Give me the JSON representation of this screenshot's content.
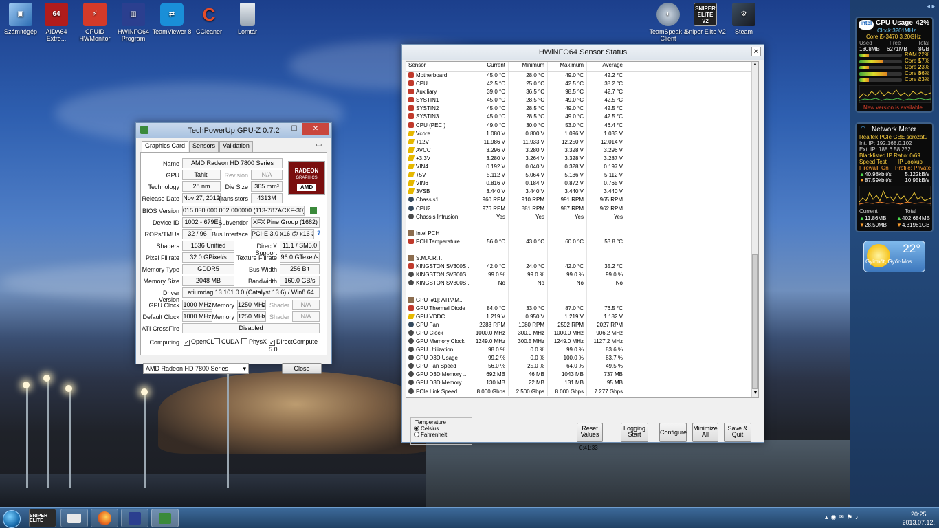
{
  "desktop_icons_left": [
    {
      "label": "Számítógép",
      "icon": "computer-icon"
    },
    {
      "label": "AIDA64 Extre...",
      "icon": "aida64-icon"
    },
    {
      "label": "CPUID HWMonitor",
      "icon": "hwmonitor-icon"
    },
    {
      "label": "HWiNFO64 Program",
      "icon": "hwinfo-icon"
    },
    {
      "label": "TeamViewer 8",
      "icon": "teamviewer-icon"
    },
    {
      "label": "CCleaner",
      "icon": "ccleaner-icon"
    },
    {
      "label": "Lomtár",
      "icon": "recycle-bin-icon"
    }
  ],
  "desktop_icons_right": [
    {
      "label": "TeamSpeak 3 Client",
      "icon": "teamspeak-icon"
    },
    {
      "label": "Sniper Elite V2",
      "icon": "sniper-elite-icon",
      "badge": "SNIPER ELITE V2"
    },
    {
      "label": "Steam",
      "icon": "steam-icon"
    }
  ],
  "gpuz": {
    "title": "TechPowerUp GPU-Z 0.7.2",
    "tabs": [
      "Graphics Card",
      "Sensors",
      "Validation"
    ],
    "logo": {
      "line1": "RADEON",
      "line2": "GRAPHICS",
      "brand": "AMD"
    },
    "rows": {
      "name_label": "Name",
      "name": "AMD Radeon HD 7800 Series",
      "gpu_label": "GPU",
      "gpu": "Tahiti",
      "revision_label": "Revision",
      "revision": "N/A",
      "technology_label": "Technology",
      "technology": "28 nm",
      "die_size_label": "Die Size",
      "die_size": "365 mm²",
      "release_label": "Release Date",
      "release": "Nov 27, 2012",
      "transistors_label": "Transistors",
      "transistors": "4313M",
      "bios_label": "BIOS Version",
      "bios": "015.030.000.002.000000 (113-787ACXF-30)",
      "device_label": "Device ID",
      "device": "1002 - 679E",
      "subvendor_label": "Subvendor",
      "subvendor": "XFX Pine Group (1682)",
      "rops_label": "ROPs/TMUs",
      "rops": "32 / 96",
      "bus_label": "Bus Interface",
      "bus": "PCI-E 3.0 x16 @ x16 3.0",
      "shaders_label": "Shaders",
      "shaders": "1536 Unified",
      "directx_label": "DirectX Support",
      "directx": "11.1 / SM5.0",
      "pixel_label": "Pixel Fillrate",
      "pixel": "32.0 GPixel/s",
      "texture_label": "Texture Fillrate",
      "texture": "96.0 GTexel/s",
      "memtype_label": "Memory Type",
      "memtype": "GDDR5",
      "buswidth_label": "Bus Width",
      "buswidth": "256 Bit",
      "memsize_label": "Memory Size",
      "memsize": "2048 MB",
      "bandwidth_label": "Bandwidth",
      "bandwidth": "160.0 GB/s",
      "driver_label": "Driver Version",
      "driver": "atiumdag 13.101.0.0 (Catalyst 13.6) / Win8 64",
      "gpuclock_label": "GPU Clock",
      "gpuclock": "1000 MHz",
      "memory_label": "Memory",
      "memclock": "1250 MHz",
      "shader_label": "Shader",
      "shader": "N/A",
      "defclock_label": "Default Clock",
      "defclock": "1000 MHz",
      "defmem": "1250 MHz",
      "defshader": "N/A",
      "crossfire_label": "ATI CrossFire",
      "crossfire": "Disabled",
      "computing_label": "Computing",
      "opencl": "OpenCL",
      "cuda": "CUDA",
      "physx": "PhysX",
      "directcompute": "DirectCompute 5.0"
    },
    "card_select": "AMD Radeon HD 7800 Series",
    "close_label": "Close",
    "help": "?"
  },
  "hwinfo": {
    "title": "HWiNFO64 Sensor Status",
    "columns": [
      "Sensor",
      "Current",
      "Minimum",
      "Maximum",
      "Average"
    ],
    "rows": [
      {
        "n": "Motherboard",
        "c": "45.0 °C",
        "mi": "28.0 °C",
        "ma": "49.0 °C",
        "av": "42.2 °C",
        "i": "temp"
      },
      {
        "n": "CPU",
        "c": "42.5 °C",
        "mi": "25.0 °C",
        "ma": "42.5 °C",
        "av": "38.2 °C",
        "i": "temp"
      },
      {
        "n": "Auxiliary",
        "c": "39.0 °C",
        "mi": "36.5 °C",
        "ma": "98.5 °C",
        "av": "42.7 °C",
        "i": "temp"
      },
      {
        "n": "SYSTIN1",
        "c": "45.0 °C",
        "mi": "28.5 °C",
        "ma": "49.0 °C",
        "av": "42.5 °C",
        "i": "temp"
      },
      {
        "n": "SYSTIN2",
        "c": "45.0 °C",
        "mi": "28.5 °C",
        "ma": "49.0 °C",
        "av": "42.5 °C",
        "i": "temp"
      },
      {
        "n": "SYSTIN3",
        "c": "45.0 °C",
        "mi": "28.5 °C",
        "ma": "49.0 °C",
        "av": "42.5 °C",
        "i": "temp"
      },
      {
        "n": "CPU (PECI)",
        "c": "49.0 °C",
        "mi": "30.0 °C",
        "ma": "53.0 °C",
        "av": "46.4 °C",
        "i": "temp"
      },
      {
        "n": "Vcore",
        "c": "1.080 V",
        "mi": "0.800 V",
        "ma": "1.096 V",
        "av": "1.033 V",
        "i": "volt"
      },
      {
        "n": "+12V",
        "c": "11.986 V",
        "mi": "11.933 V",
        "ma": "12.250 V",
        "av": "12.014 V",
        "i": "volt"
      },
      {
        "n": "AVCC",
        "c": "3.296 V",
        "mi": "3.280 V",
        "ma": "3.328 V",
        "av": "3.296 V",
        "i": "volt"
      },
      {
        "n": "+3.3V",
        "c": "3.280 V",
        "mi": "3.264 V",
        "ma": "3.328 V",
        "av": "3.287 V",
        "i": "volt"
      },
      {
        "n": "VIN4",
        "c": "0.192 V",
        "mi": "0.040 V",
        "ma": "0.328 V",
        "av": "0.197 V",
        "i": "volt"
      },
      {
        "n": "+5V",
        "c": "5.112 V",
        "mi": "5.064 V",
        "ma": "5.136 V",
        "av": "5.112 V",
        "i": "volt"
      },
      {
        "n": "VIN6",
        "c": "0.816 V",
        "mi": "0.184 V",
        "ma": "0.872 V",
        "av": "0.765 V",
        "i": "volt"
      },
      {
        "n": "3VSB",
        "c": "3.440 V",
        "mi": "3.440 V",
        "ma": "3.440 V",
        "av": "3.440 V",
        "i": "volt"
      },
      {
        "n": "Chassis1",
        "c": "960 RPM",
        "mi": "910 RPM",
        "ma": "991 RPM",
        "av": "965 RPM",
        "i": "fan"
      },
      {
        "n": "CPU2",
        "c": "976 RPM",
        "mi": "881 RPM",
        "ma": "987 RPM",
        "av": "962 RPM",
        "i": "fan"
      },
      {
        "n": "Chassis Intrusion",
        "c": "Yes",
        "mi": "Yes",
        "ma": "Yes",
        "av": "Yes",
        "i": "gen"
      },
      {
        "n": "",
        "c": "",
        "mi": "",
        "ma": "",
        "av": "",
        "i": ""
      },
      {
        "n": "Intel PCH",
        "c": "",
        "mi": "",
        "ma": "",
        "av": "",
        "i": "dev"
      },
      {
        "n": "PCH Temperature",
        "c": "56.0 °C",
        "mi": "43.0 °C",
        "ma": "60.0 °C",
        "av": "53.8 °C",
        "i": "temp"
      },
      {
        "n": "",
        "c": "",
        "mi": "",
        "ma": "",
        "av": "",
        "i": ""
      },
      {
        "n": "S.M.A.R.T.",
        "c": "",
        "mi": "",
        "ma": "",
        "av": "",
        "i": "dev"
      },
      {
        "n": "KINGSTON SV300S...",
        "c": "42.0 °C",
        "mi": "24.0 °C",
        "ma": "42.0 °C",
        "av": "35.2 °C",
        "i": "temp"
      },
      {
        "n": "KINGSTON SV300S...",
        "c": "99.0 %",
        "mi": "99.0 %",
        "ma": "99.0 %",
        "av": "99.0 %",
        "i": "gen"
      },
      {
        "n": "KINGSTON SV300S...",
        "c": "No",
        "mi": "No",
        "ma": "No",
        "av": "No",
        "i": "gen"
      },
      {
        "n": "",
        "c": "",
        "mi": "",
        "ma": "",
        "av": "",
        "i": ""
      },
      {
        "n": "GPU [#1]: ATI/AM...",
        "c": "",
        "mi": "",
        "ma": "",
        "av": "",
        "i": "dev"
      },
      {
        "n": "GPU Thermal Diode",
        "c": "84.0 °C",
        "mi": "33.0 °C",
        "ma": "87.0 °C",
        "av": "76.5 °C",
        "i": "temp"
      },
      {
        "n": "GPU VDDC",
        "c": "1.219 V",
        "mi": "0.950 V",
        "ma": "1.219 V",
        "av": "1.182 V",
        "i": "volt"
      },
      {
        "n": "GPU Fan",
        "c": "2283 RPM",
        "mi": "1080 RPM",
        "ma": "2592 RPM",
        "av": "2027 RPM",
        "i": "fan"
      },
      {
        "n": "GPU Clock",
        "c": "1000.0 MHz",
        "mi": "300.0 MHz",
        "ma": "1000.0 MHz",
        "av": "906.2 MHz",
        "i": "gen"
      },
      {
        "n": "GPU Memory Clock",
        "c": "1249.0 MHz",
        "mi": "300.5 MHz",
        "ma": "1249.0 MHz",
        "av": "1127.2 MHz",
        "i": "gen"
      },
      {
        "n": "GPU Utilization",
        "c": "98.0 %",
        "mi": "0.0 %",
        "ma": "99.0 %",
        "av": "83.6 %",
        "i": "gen"
      },
      {
        "n": "GPU D3D Usage",
        "c": "99.2 %",
        "mi": "0.0 %",
        "ma": "100.0 %",
        "av": "83.7 %",
        "i": "gen"
      },
      {
        "n": "GPU Fan Speed",
        "c": "56.0 %",
        "mi": "25.0 %",
        "ma": "64.0 %",
        "av": "49.5 %",
        "i": "gen"
      },
      {
        "n": "GPU D3D Memory ...",
        "c": "692 MB",
        "mi": "46 MB",
        "ma": "1043 MB",
        "av": "737 MB",
        "i": "gen"
      },
      {
        "n": "GPU D3D Memory ...",
        "c": "130 MB",
        "mi": "22 MB",
        "ma": "131 MB",
        "av": "95 MB",
        "i": "gen"
      },
      {
        "n": "PCIe Link Speed",
        "c": "8.000 Gbps",
        "mi": "2.500 Gbps",
        "ma": "8.000 Gbps",
        "av": "7.277 Gbps",
        "i": "gen"
      }
    ],
    "temperature_group": "Temperature",
    "celsius": "Celsius",
    "fahrenheit": "Fahrenheit",
    "reset_label": "Reset Values",
    "elapsed": "0:41:33",
    "logging_label": "Logging Start",
    "configure_label": "Configure",
    "minimize_label": "Minimize All",
    "save_label": "Save & Quit"
  },
  "cpu_gadget": {
    "title": "CPU Usage",
    "percent": "42%",
    "clock": "Clock:3201MHz",
    "cpu_name": "Core i5-3470 3.20GHz",
    "used_label": "Used",
    "free_label": "Free",
    "total_label": "Total",
    "used": "1808MB",
    "free": "6271MB",
    "total": "8GB",
    "ram_label": "RAM",
    "ram": "22%",
    "ram_level": 0.22,
    "cores": [
      {
        "label": "Core 1",
        "value": "57%",
        "level": 0.57
      },
      {
        "label": "Core 2",
        "value": "23%",
        "level": 0.23
      },
      {
        "label": "Core 3",
        "value": "66%",
        "level": 0.66
      },
      {
        "label": "Core 4",
        "value": "23%",
        "level": 0.23
      }
    ],
    "new_version": "New version is available"
  },
  "net_gadget": {
    "title": "Network Meter",
    "adapter": "Realtek PCIe GBE sorozatú",
    "int_ip": "Int. IP: 192.168.0.102",
    "ext_ip": "Ext. IP: 188.6.58.232",
    "blacklist": "Blacklisted IP Ratio: 0/69",
    "speed_test": "Speed Test",
    "ip_lookup": "IP Lookup",
    "firewall": "Firewall: On",
    "profile": "Profile: Private",
    "up_rate": "40.98kbit/s",
    "up_rate_b": "5.122kB/s",
    "down_rate": "87.59kbit/s",
    "down_rate_b": "10.95kB/s",
    "current_label": "Current",
    "total_label": "Total",
    "cur_up": "11.86MB",
    "tot_up": "402.684MB",
    "cur_down": "28.50MB",
    "tot_down": "4.31981GB"
  },
  "weather_gadget": {
    "temp": "22°",
    "location": "Gyirmót, Győr-Mos..."
  },
  "taskbar": {
    "items": [
      {
        "name": "taskbar-sniper-elite",
        "label": "SNIPER ELITE"
      },
      {
        "name": "taskbar-explorer",
        "label": ""
      },
      {
        "name": "taskbar-firefox",
        "label": ""
      },
      {
        "name": "taskbar-hwinfo",
        "label": ""
      },
      {
        "name": "taskbar-gpuz",
        "label": ""
      }
    ],
    "time": "20:25",
    "date": "2013.07.12."
  }
}
